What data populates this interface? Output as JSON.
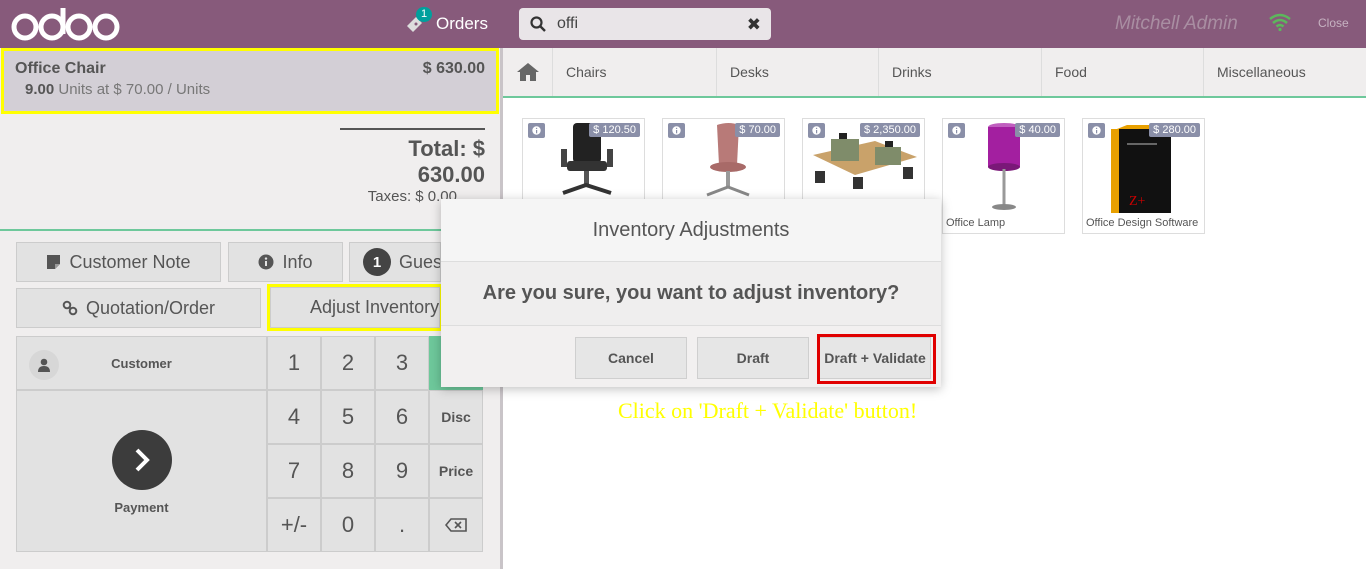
{
  "app": {
    "brand": "odoo",
    "brand_color": "#875a7b",
    "accent": "#6ec89b"
  },
  "header": {
    "orders_label": "Orders",
    "orders_count": "1",
    "search_value": "offi",
    "user_name": "Mitchell Admin",
    "close_label": "Close"
  },
  "order": {
    "line": {
      "product": "Office Chair",
      "price": "$ 630.00",
      "qty": "9.00",
      "detail": "Units at $ 70.00 / Units"
    },
    "total": "Total: $ 630.00",
    "taxes": "Taxes: $ 0.00"
  },
  "controls": {
    "customer_note": "Customer Note",
    "info": "Info",
    "guests_count": "1",
    "guests": "Guests",
    "quotation": "Quotation/Order",
    "adjust_inventory": "Adjust Inventory"
  },
  "numpad": {
    "customer": "Customer",
    "payment": "Payment",
    "keys": [
      "1",
      "2",
      "3",
      "4",
      "5",
      "6",
      "7",
      "8",
      "9",
      "+/-",
      "0",
      "."
    ],
    "disc": "Disc",
    "price": "Price"
  },
  "categories": [
    "Chairs",
    "Desks",
    "Drinks",
    "Food",
    "Miscellaneous"
  ],
  "products": [
    {
      "name": "",
      "price": "$ 120.50"
    },
    {
      "name": "",
      "price": "$ 70.00"
    },
    {
      "name": "",
      "price": "$ 2,350.00"
    },
    {
      "name": "Office Lamp",
      "price": "$ 40.00"
    },
    {
      "name": "Office Design Software",
      "price": "$ 280.00"
    }
  ],
  "modal": {
    "title": "Inventory Adjustments",
    "message": "Are you sure, you want to adjust inventory?",
    "cancel": "Cancel",
    "draft": "Draft",
    "draft_validate": "Draft + Validate"
  },
  "annotation": {
    "hint": "Click on 'Draft + Validate' button!"
  }
}
